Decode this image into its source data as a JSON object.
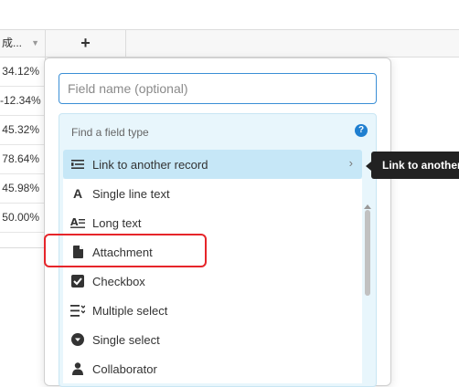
{
  "grid": {
    "column_header": "成...",
    "add_column": "+",
    "cells": [
      "34.12%",
      "-12.34%",
      "45.32%",
      "78.64%",
      "45.98%",
      "50.00%"
    ]
  },
  "popup": {
    "field_name_placeholder": "Field name (optional)",
    "find_label": "Find a field type",
    "help": "?",
    "items": [
      {
        "label": "Link to another record",
        "icon": "link-record-icon"
      },
      {
        "label": "Single line text",
        "icon": "text-a-icon"
      },
      {
        "label": "Long text",
        "icon": "long-text-icon"
      },
      {
        "label": "Attachment",
        "icon": "document-icon"
      },
      {
        "label": "Checkbox",
        "icon": "checkbox-icon"
      },
      {
        "label": "Multiple select",
        "icon": "multi-select-icon"
      },
      {
        "label": "Single select",
        "icon": "single-select-icon"
      },
      {
        "label": "Collaborator",
        "icon": "user-icon"
      }
    ]
  },
  "tooltip": {
    "text": "Link to another record"
  },
  "colors": {
    "accent": "#1f7fd0",
    "highlight": "#e6252a",
    "panel_bg": "#e8f6fc"
  }
}
